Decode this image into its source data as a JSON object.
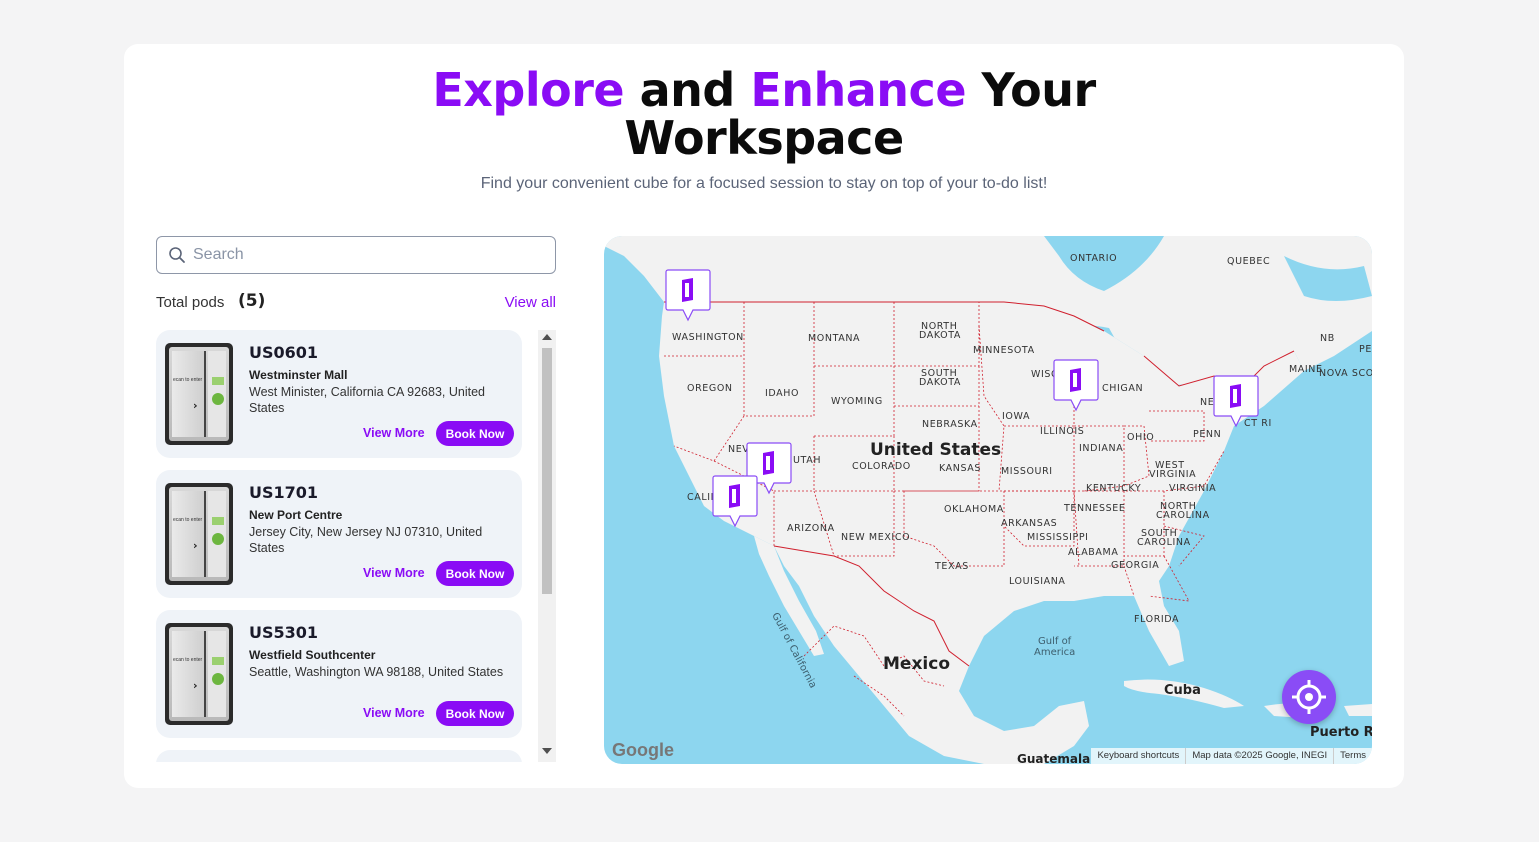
{
  "header": {
    "title_word1": "Explore",
    "title_word2": " and ",
    "title_word3": "Enhance",
    "title_word4": " Your",
    "title_line2": "Workspace",
    "subtitle": "Find your convenient cube for a focused session to stay on top of your to-do list!"
  },
  "search": {
    "placeholder": "Search",
    "value": ""
  },
  "pods_summary": {
    "label": "Total pods",
    "count": "(5)",
    "view_all": "View all"
  },
  "pods": [
    {
      "id": "US0601",
      "venue": "Westminster Mall",
      "address": "West Minister, California CA 92683, United States",
      "view_more": "View More",
      "book_now": "Book Now"
    },
    {
      "id": "US1701",
      "venue": "New Port Centre",
      "address": "Jersey City, New Jersey NJ 07310, United States",
      "view_more": "View More",
      "book_now": "Book Now"
    },
    {
      "id": "US5301",
      "venue": "Westfield Southcenter",
      "address": "Seattle, Washington WA 98188, United States",
      "view_more": "View More",
      "book_now": "Book Now"
    }
  ],
  "map": {
    "country_labels": {
      "us": "United States",
      "mexico": "Mexico",
      "cuba": "Cuba",
      "puerto_rico": "Puerto Rico",
      "guatemala": "Guatemala"
    },
    "region_labels": {
      "ontario": "ONTARIO",
      "quebec": "QUEBEC",
      "washington": "WASHINGTON",
      "montana": "MONTANA",
      "north_dakota_1": "NORTH",
      "north_dakota_2": "DAKOTA",
      "minnesota": "MINNESOTA",
      "south_dakota_1": "SOUTH",
      "south_dakota_2": "DAKOTA",
      "oregon": "OREGON",
      "idaho": "IDAHO",
      "wyoming": "WYOMING",
      "nebraska": "NEBRASKA",
      "iowa": "IOWA",
      "wisc": "WISC",
      "michigan": "CHIGAN",
      "nb": "NB",
      "pe": "PE",
      "maine": "MAINE",
      "nova_scotia": "NOVA SCO",
      "new_york": "NEW",
      "ct_ri": "CT RI",
      "nevada": "NEV",
      "utah": "UTAH",
      "colorado": "COLORADO",
      "kansas": "KANSAS",
      "missouri": "MISSOURI",
      "illinois": "ILLINOIS",
      "indiana": "INDIANA",
      "ohio": "OHIO",
      "penn": "PENN",
      "california": "CALIF",
      "west_virginia_1": "WEST",
      "west_virginia_2": "VIRGINIA",
      "virginia": "VIRGINIA",
      "kentucky": "KENTUCKY",
      "arizona": "ARIZONA",
      "new_mexico": "NEW MEXICO",
      "oklahoma": "OKLAHOMA",
      "arkansas": "ARKANSAS",
      "tennessee": "TENNESSEE",
      "north_carolina_1": "NORTH",
      "north_carolina_2": "CAROLINA",
      "mississippi": "MISSISSIPPI",
      "alabama": "ALABAMA",
      "south_carolina_1": "SOUTH",
      "south_carolina_2": "CAROLINA",
      "texas": "TEXAS",
      "louisiana": "LOUISIANA",
      "georgia": "GEORGIA",
      "florida": "FLORIDA"
    },
    "water_labels": {
      "gulf_of_mexico_1": "Gulf of",
      "gulf_of_mexico_2": "America",
      "gulf_of_california": "Gulf of California"
    },
    "google_logo": "Google",
    "attribution": {
      "shortcuts": "Keyboard shortcuts",
      "data": "Map data ©2025 Google, INEGI",
      "terms": "Terms"
    }
  },
  "colors": {
    "accent": "#8a0cf5",
    "card_bg": "#eff3f8",
    "water": "#8dd6ef",
    "land": "#f2f2f2",
    "border_red": "#d0202e"
  },
  "icons": {
    "search": "search-icon",
    "pod_marker": "pod-marker-icon",
    "locate": "crosshair-icon"
  }
}
